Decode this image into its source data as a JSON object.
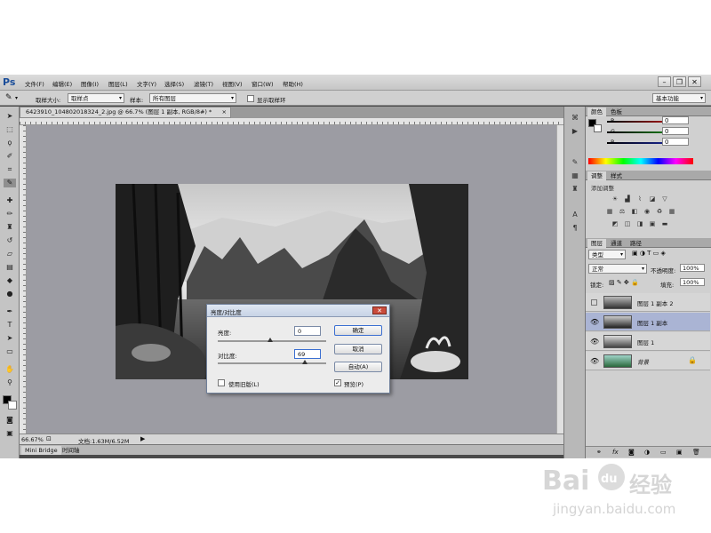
{
  "app": {
    "logo": "Ps",
    "menu": [
      "文件(F)",
      "编辑(E)",
      "图像(I)",
      "图层(L)",
      "文字(Y)",
      "选择(S)",
      "滤镜(T)",
      "视图(V)",
      "窗口(W)",
      "帮助(H)"
    ],
    "window_controls": [
      "–",
      "❐",
      "✕"
    ]
  },
  "options_bar": {
    "sample_size_label": "取样大小:",
    "sample_size_value": "取样点",
    "sample_label": "样本:",
    "sample_value": "所有图层",
    "show_ring_label": "显示取样环",
    "workspace": "基本功能"
  },
  "document": {
    "tab_title": "6423910_104802018324_2.jpg @ 66.7% (图层 1 副本, RGB/8#) *",
    "tab_close": "×",
    "zoom": "66.67%",
    "doc_info": "文档:1.63M/6.52M"
  },
  "bottom_tabs": [
    "Mini Bridge",
    "时间轴"
  ],
  "tools": [
    "move-tool",
    "marquee-tool",
    "lasso-tool",
    "quick-select-tool",
    "crop-tool",
    "eyedropper-tool",
    "healing-tool",
    "brush-tool",
    "stamp-tool",
    "history-brush-tool",
    "eraser-tool",
    "gradient-tool",
    "blur-tool",
    "dodge-tool",
    "pen-tool",
    "type-tool",
    "path-select-tool",
    "shape-tool",
    "hand-tool",
    "zoom-tool"
  ],
  "color_panel": {
    "tabs": [
      "颜色",
      "色板"
    ],
    "channels": [
      {
        "name": "R",
        "value": "0",
        "color": "#d62020"
      },
      {
        "name": "G",
        "value": "0",
        "color": "#20a020"
      },
      {
        "name": "B",
        "value": "0",
        "color": "#2030c0"
      }
    ]
  },
  "adjustments_panel": {
    "tabs": [
      "调整",
      "样式"
    ],
    "hint": "添加调整"
  },
  "layers_panel": {
    "tabs": [
      "图层",
      "通道",
      "路径"
    ],
    "filter": "类型",
    "blend_mode": "正常",
    "opacity_label": "不透明度:",
    "opacity_value": "100%",
    "lock_label": "锁定:",
    "fill_label": "填充:",
    "fill_value": "100%",
    "layers": [
      {
        "name": "图层 1 副本 2",
        "visible": false,
        "selected": false
      },
      {
        "name": "图层 1 副本",
        "visible": true,
        "selected": true
      },
      {
        "name": "图层 1",
        "visible": true,
        "selected": false
      },
      {
        "name": "背景",
        "visible": true,
        "selected": false,
        "locked": true
      }
    ],
    "footer_icons": [
      "link-icon",
      "fx-icon",
      "mask-icon",
      "adjustment-icon",
      "group-icon",
      "new-layer-icon",
      "trash-icon"
    ]
  },
  "dialog": {
    "title": "亮度/对比度",
    "brightness_label": "亮度:",
    "brightness_value": "0",
    "contrast_label": "对比度:",
    "contrast_value": "69",
    "legacy_label": "使用旧版(L)",
    "legacy_checked": false,
    "preview_label": "预览(P)",
    "preview_checked": true,
    "ok": "确定",
    "cancel": "取消",
    "auto": "自动(A)"
  },
  "watermark": {
    "brand": "Bai",
    "brand2": "du",
    "cn": "经验",
    "url": "jingyan.baidu.com"
  }
}
